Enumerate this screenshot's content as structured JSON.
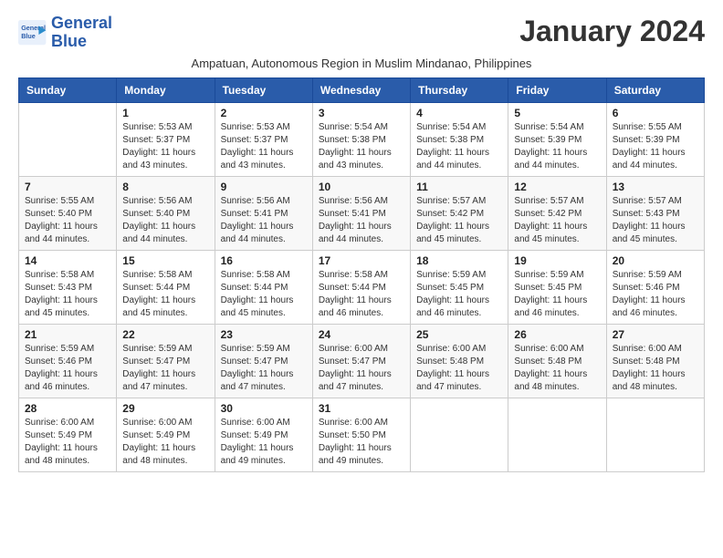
{
  "header": {
    "logo_line1": "General",
    "logo_line2": "Blue",
    "month_title": "January 2024",
    "subtitle": "Ampatuan, Autonomous Region in Muslim Mindanao, Philippines"
  },
  "days_of_week": [
    "Sunday",
    "Monday",
    "Tuesday",
    "Wednesday",
    "Thursday",
    "Friday",
    "Saturday"
  ],
  "weeks": [
    [
      {
        "day": "",
        "detail": ""
      },
      {
        "day": "1",
        "detail": "Sunrise: 5:53 AM\nSunset: 5:37 PM\nDaylight: 11 hours\nand 43 minutes."
      },
      {
        "day": "2",
        "detail": "Sunrise: 5:53 AM\nSunset: 5:37 PM\nDaylight: 11 hours\nand 43 minutes."
      },
      {
        "day": "3",
        "detail": "Sunrise: 5:54 AM\nSunset: 5:38 PM\nDaylight: 11 hours\nand 43 minutes."
      },
      {
        "day": "4",
        "detail": "Sunrise: 5:54 AM\nSunset: 5:38 PM\nDaylight: 11 hours\nand 44 minutes."
      },
      {
        "day": "5",
        "detail": "Sunrise: 5:54 AM\nSunset: 5:39 PM\nDaylight: 11 hours\nand 44 minutes."
      },
      {
        "day": "6",
        "detail": "Sunrise: 5:55 AM\nSunset: 5:39 PM\nDaylight: 11 hours\nand 44 minutes."
      }
    ],
    [
      {
        "day": "7",
        "detail": "Sunrise: 5:55 AM\nSunset: 5:40 PM\nDaylight: 11 hours\nand 44 minutes."
      },
      {
        "day": "8",
        "detail": "Sunrise: 5:56 AM\nSunset: 5:40 PM\nDaylight: 11 hours\nand 44 minutes."
      },
      {
        "day": "9",
        "detail": "Sunrise: 5:56 AM\nSunset: 5:41 PM\nDaylight: 11 hours\nand 44 minutes."
      },
      {
        "day": "10",
        "detail": "Sunrise: 5:56 AM\nSunset: 5:41 PM\nDaylight: 11 hours\nand 44 minutes."
      },
      {
        "day": "11",
        "detail": "Sunrise: 5:57 AM\nSunset: 5:42 PM\nDaylight: 11 hours\nand 45 minutes."
      },
      {
        "day": "12",
        "detail": "Sunrise: 5:57 AM\nSunset: 5:42 PM\nDaylight: 11 hours\nand 45 minutes."
      },
      {
        "day": "13",
        "detail": "Sunrise: 5:57 AM\nSunset: 5:43 PM\nDaylight: 11 hours\nand 45 minutes."
      }
    ],
    [
      {
        "day": "14",
        "detail": "Sunrise: 5:58 AM\nSunset: 5:43 PM\nDaylight: 11 hours\nand 45 minutes."
      },
      {
        "day": "15",
        "detail": "Sunrise: 5:58 AM\nSunset: 5:44 PM\nDaylight: 11 hours\nand 45 minutes."
      },
      {
        "day": "16",
        "detail": "Sunrise: 5:58 AM\nSunset: 5:44 PM\nDaylight: 11 hours\nand 45 minutes."
      },
      {
        "day": "17",
        "detail": "Sunrise: 5:58 AM\nSunset: 5:44 PM\nDaylight: 11 hours\nand 46 minutes."
      },
      {
        "day": "18",
        "detail": "Sunrise: 5:59 AM\nSunset: 5:45 PM\nDaylight: 11 hours\nand 46 minutes."
      },
      {
        "day": "19",
        "detail": "Sunrise: 5:59 AM\nSunset: 5:45 PM\nDaylight: 11 hours\nand 46 minutes."
      },
      {
        "day": "20",
        "detail": "Sunrise: 5:59 AM\nSunset: 5:46 PM\nDaylight: 11 hours\nand 46 minutes."
      }
    ],
    [
      {
        "day": "21",
        "detail": "Sunrise: 5:59 AM\nSunset: 5:46 PM\nDaylight: 11 hours\nand 46 minutes."
      },
      {
        "day": "22",
        "detail": "Sunrise: 5:59 AM\nSunset: 5:47 PM\nDaylight: 11 hours\nand 47 minutes."
      },
      {
        "day": "23",
        "detail": "Sunrise: 5:59 AM\nSunset: 5:47 PM\nDaylight: 11 hours\nand 47 minutes."
      },
      {
        "day": "24",
        "detail": "Sunrise: 6:00 AM\nSunset: 5:47 PM\nDaylight: 11 hours\nand 47 minutes."
      },
      {
        "day": "25",
        "detail": "Sunrise: 6:00 AM\nSunset: 5:48 PM\nDaylight: 11 hours\nand 47 minutes."
      },
      {
        "day": "26",
        "detail": "Sunrise: 6:00 AM\nSunset: 5:48 PM\nDaylight: 11 hours\nand 48 minutes."
      },
      {
        "day": "27",
        "detail": "Sunrise: 6:00 AM\nSunset: 5:48 PM\nDaylight: 11 hours\nand 48 minutes."
      }
    ],
    [
      {
        "day": "28",
        "detail": "Sunrise: 6:00 AM\nSunset: 5:49 PM\nDaylight: 11 hours\nand 48 minutes."
      },
      {
        "day": "29",
        "detail": "Sunrise: 6:00 AM\nSunset: 5:49 PM\nDaylight: 11 hours\nand 48 minutes."
      },
      {
        "day": "30",
        "detail": "Sunrise: 6:00 AM\nSunset: 5:49 PM\nDaylight: 11 hours\nand 49 minutes."
      },
      {
        "day": "31",
        "detail": "Sunrise: 6:00 AM\nSunset: 5:50 PM\nDaylight: 11 hours\nand 49 minutes."
      },
      {
        "day": "",
        "detail": ""
      },
      {
        "day": "",
        "detail": ""
      },
      {
        "day": "",
        "detail": ""
      }
    ]
  ]
}
